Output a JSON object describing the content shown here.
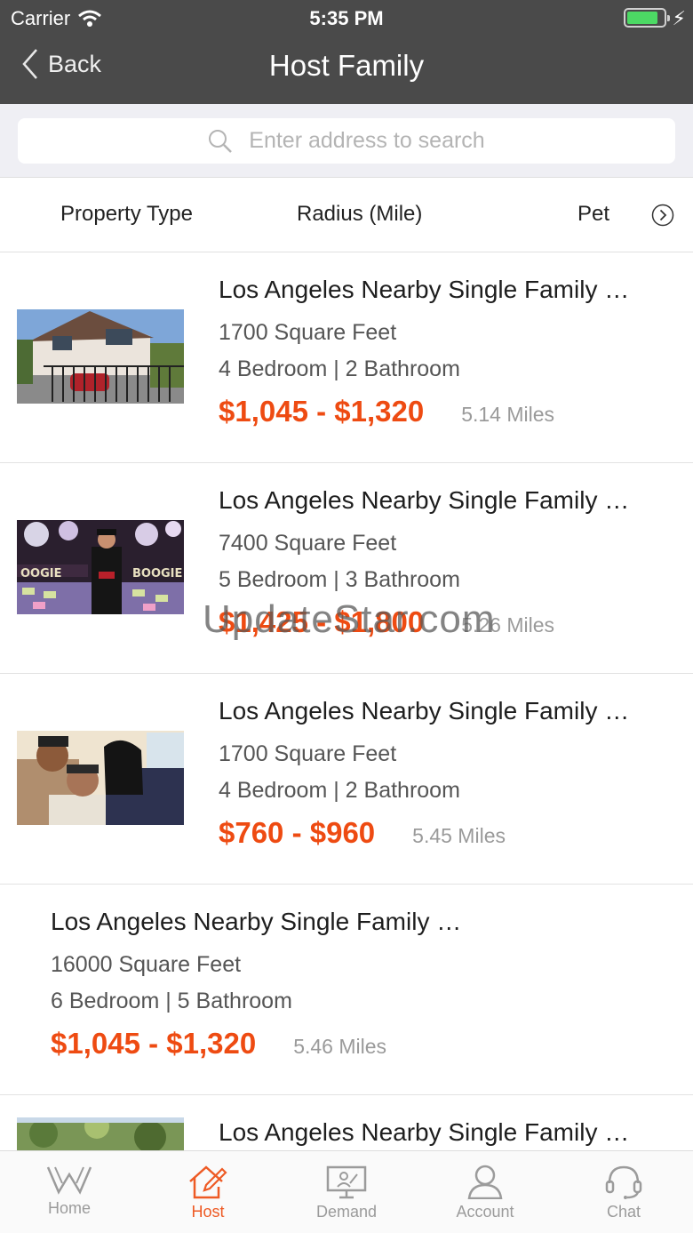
{
  "status_bar": {
    "carrier": "Carrier",
    "time": "5:35 PM"
  },
  "nav": {
    "back_label": "Back",
    "title": "Host Family"
  },
  "search": {
    "placeholder": "Enter address to search"
  },
  "filters": {
    "items": [
      "Property Type",
      "Radius (Mile)",
      "Pet"
    ]
  },
  "listings": [
    {
      "title": "Los Angeles Nearby Single Family …",
      "area": "1700 Square Feet",
      "rooms": "4 Bedroom | 2 Bathroom",
      "price": "$1,045 - $1,320",
      "distance": "5.14 Miles"
    },
    {
      "title": "Los Angeles Nearby Single Family …",
      "area": "7400 Square Feet",
      "rooms": "5 Bedroom | 3 Bathroom",
      "price": "$1,425 - $1,800",
      "distance": "5.26 Miles"
    },
    {
      "title": "Los Angeles Nearby Single Family …",
      "area": "1700 Square Feet",
      "rooms": "4 Bedroom | 2 Bathroom",
      "price": "$760 - $960",
      "distance": "5.45 Miles"
    },
    {
      "title": "Los Angeles Nearby Single Family …",
      "area": "16000 Square Feet",
      "rooms": "6 Bedroom | 5 Bathroom",
      "price": "$1,045 - $1,320",
      "distance": "5.46 Miles"
    },
    {
      "title": "Los Angeles Nearby Single Family …"
    }
  ],
  "watermark": "UpdateStar.com",
  "tabbar": {
    "tabs": [
      {
        "label": "Home",
        "icon": "w-logo-icon",
        "active": false
      },
      {
        "label": "Host",
        "icon": "house-edit-icon",
        "active": true
      },
      {
        "label": "Demand",
        "icon": "monitor-person-icon",
        "active": false
      },
      {
        "label": "Account",
        "icon": "user-icon",
        "active": false
      },
      {
        "label": "Chat",
        "icon": "headset-icon",
        "active": false
      }
    ]
  },
  "colors": {
    "accent": "#ee4b12",
    "header_bg": "#4a4a4a",
    "tab_active": "#ee5a24"
  }
}
